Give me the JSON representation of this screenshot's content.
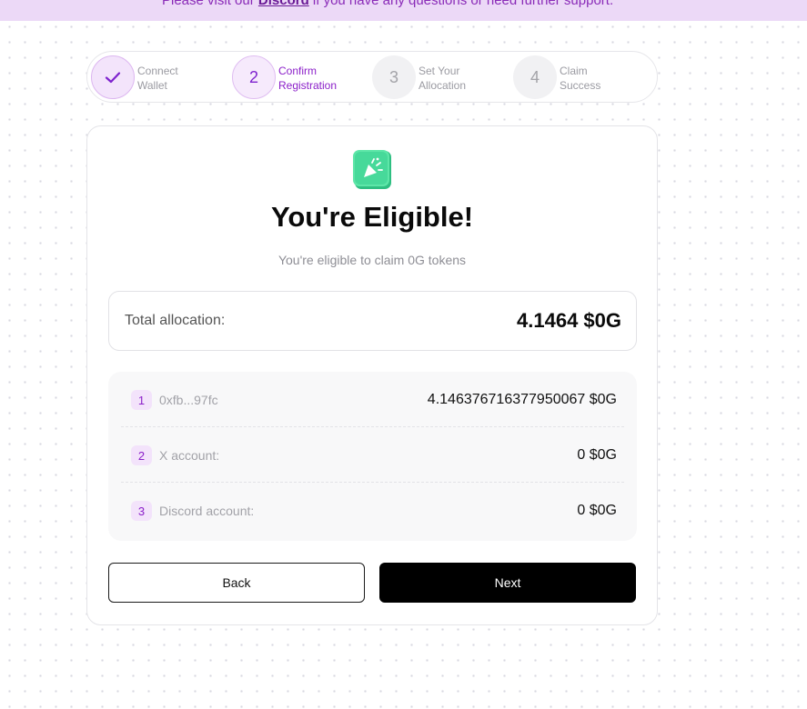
{
  "banner": {
    "text_before": "Please visit our ",
    "link": "Discord",
    "text_after": " if you have any questions or need further support."
  },
  "stepper": {
    "steps": [
      {
        "num": "",
        "line1": "Connect",
        "line2": "Wallet",
        "state": "done"
      },
      {
        "num": "2",
        "line1": "Confirm",
        "line2": "Registration",
        "state": "active"
      },
      {
        "num": "3",
        "line1": "Set Your",
        "line2": "Allocation",
        "state": "pending"
      },
      {
        "num": "4",
        "line1": "Claim",
        "line2": "Success",
        "state": "pending"
      }
    ]
  },
  "card": {
    "icon": "party-popper-icon",
    "title": "You're Eligible!",
    "subtitle": "You're eligible to claim 0G tokens",
    "allocation": {
      "label": "Total allocation:",
      "value": "4.1464 $0G"
    },
    "rows": [
      {
        "num": "1",
        "label": "0xfb...97fc",
        "value": "4.146376716377950067 $0G"
      },
      {
        "num": "2",
        "label": "X account:",
        "value": "0 $0G"
      },
      {
        "num": "3",
        "label": "Discord account:",
        "value": "0 $0G"
      }
    ],
    "back_label": "Back",
    "next_label": "Next"
  },
  "colors": {
    "accent": "#8b1fc9",
    "banner_bg": "#ecd9f7",
    "logo_green": "#3ddc97"
  }
}
